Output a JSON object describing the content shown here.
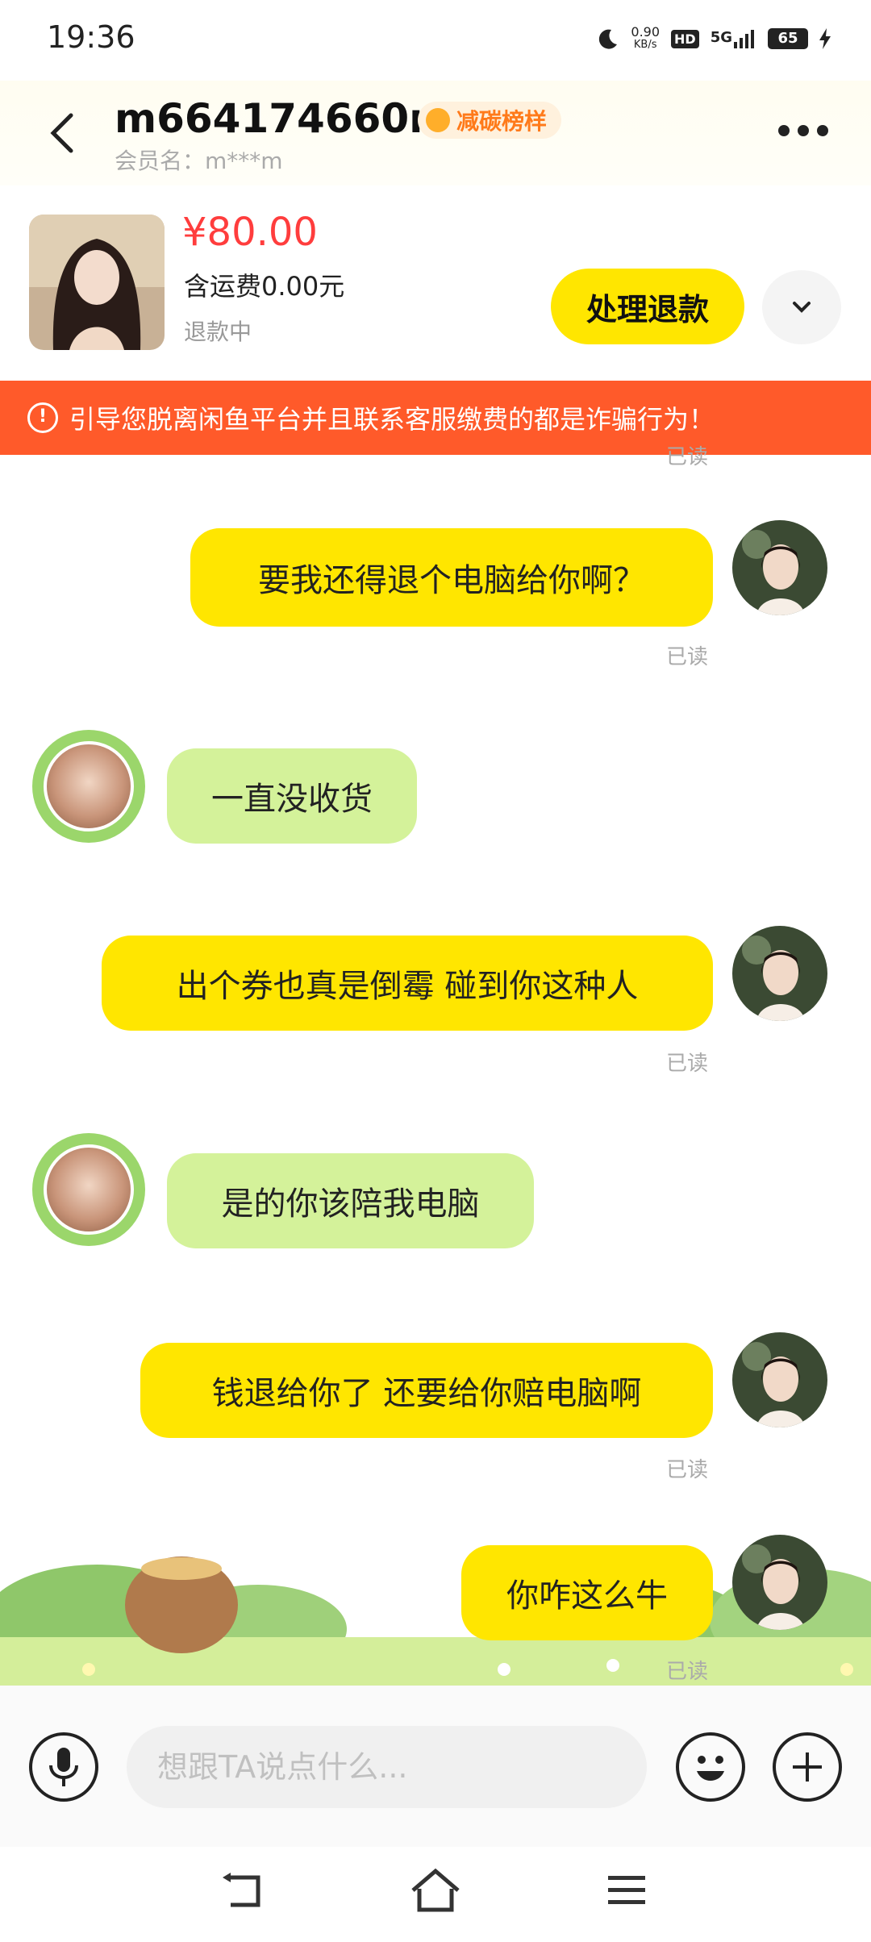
{
  "status_bar": {
    "time": "19:36",
    "net_speed_value": "0.90",
    "net_speed_unit": "KB/s",
    "hd": "HD",
    "network": "5G",
    "battery": "65"
  },
  "header": {
    "title": "m664174660m",
    "badge": "减碳榜样",
    "member_label": "会员名：m***m"
  },
  "product": {
    "price": "¥80.00",
    "shipping": "含运费0.00元",
    "status": "退款中",
    "action_label": "处理退款"
  },
  "warning": {
    "icon": "!",
    "text": "引导您脱离闲鱼平台并且联系客服缴费的都是诈骗行为！"
  },
  "messages": {
    "partial_read": "已读",
    "m1": {
      "text": "要我还得退个电脑给你啊？",
      "read": "已读"
    },
    "m2": {
      "text": "一直没收货"
    },
    "m3": {
      "text": "出个券也真是倒霉 碰到你这种人",
      "read": "已读"
    },
    "m4": {
      "text": "是的你该陪我电脑"
    },
    "m5": {
      "text": "钱退给你了 还要给你赔电脑啊",
      "read": "已读"
    },
    "m6": {
      "text": "你咋这么牛",
      "read": "已读"
    }
  },
  "input": {
    "placeholder": "想跟TA说点什么..."
  },
  "colors": {
    "accent_yellow": "#ffe600",
    "warning_orange": "#ff5a2a",
    "price_red": "#ff3d3d",
    "bubble_green": "#d4f29a"
  }
}
